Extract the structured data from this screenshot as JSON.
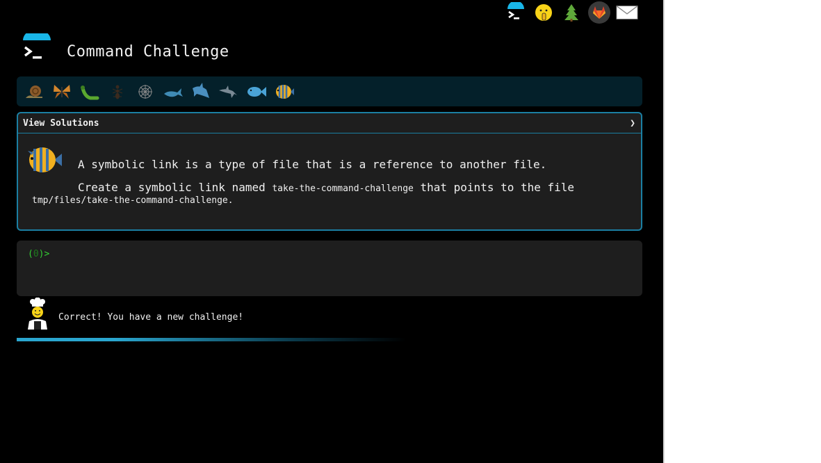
{
  "header": {
    "title": "Command Challenge",
    "top_icons": [
      "terminal-logo-icon",
      "shushing-face-icon",
      "evergreen-tree-icon",
      "gitlab-icon",
      "envelope-icon"
    ]
  },
  "levels": {
    "icons": [
      "snail-icon",
      "butterfly-icon",
      "caterpillar-icon",
      "ant-icon",
      "spiderweb-icon",
      "whale-icon",
      "shark-icon",
      "dolphin-icon",
      "fish-icon",
      "tropical-fish-icon"
    ]
  },
  "challenge": {
    "solutions_label": "View Solutions",
    "chevron": "❯",
    "line1": "A symbolic link is a type of file that is a reference to another file.",
    "line2_prefix": "Create a symbolic link named ",
    "line2_code": "take-the-command-challenge",
    "line2_suffix": " that points to the file",
    "line3_code": "tmp/files/take-the-command-challenge",
    "line3_suffix": "."
  },
  "terminal": {
    "prompt_open": "(",
    "prompt_count": "0",
    "prompt_close": ")>",
    "input_value": ""
  },
  "result": {
    "message": "Correct! You have a new challenge!"
  },
  "colors": {
    "accent": "#1b7fa3",
    "prompt_green": "#33cc33",
    "panel_bg": "#1e1e1e",
    "level_bar_bg": "#04202a"
  }
}
